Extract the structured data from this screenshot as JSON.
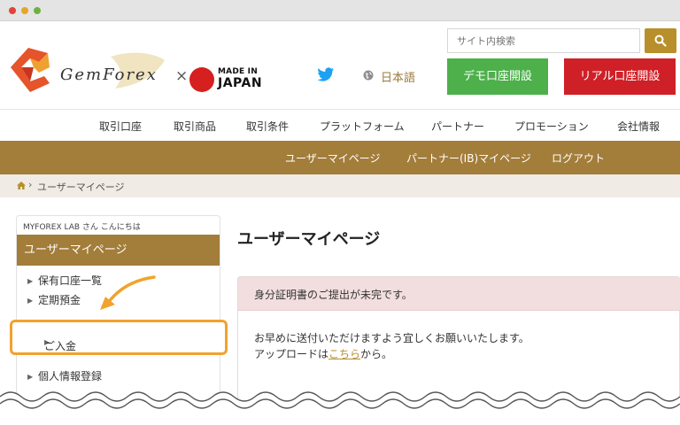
{
  "brand": {
    "logo_text": "GemForex",
    "cross": "×",
    "made_in_line1": "MADE IN",
    "made_in_line2": "JAPAN"
  },
  "header": {
    "search_placeholder": "サイト内検索",
    "language": "日本語",
    "demo_button": "デモ口座開設",
    "real_button": "リアル口座開設"
  },
  "main_nav": [
    "取引口座",
    "取引商品",
    "取引条件",
    "プラットフォーム",
    "パートナー",
    "プロモーション",
    "会社情報"
  ],
  "user_nav": [
    "ユーザーマイページ",
    "パートナー(IB)マイページ",
    "ログアウト"
  ],
  "breadcrumb": {
    "separator": "›",
    "current": "ユーザーマイページ"
  },
  "sidebar": {
    "greeting": "MYFOREX LAB さん こんにちは",
    "heading": "ユーザーマイページ",
    "items": [
      "保有口座一覧",
      "定期預金",
      "ご入金",
      "個人情報登録"
    ]
  },
  "main": {
    "title": "ユーザーマイページ",
    "alert_title": "身分証明書のご提出が未完です。",
    "alert_line1": "お早めに送付いただけますよう宜しくお願いいたします。",
    "alert_line2_before": "アップロードは",
    "alert_link": "こちら",
    "alert_line2_after": "から。"
  },
  "colors": {
    "brand_brown": "#a37d3a",
    "demo_green": "#4db04b",
    "real_red": "#cf2027",
    "highlight_orange": "#f2a22d",
    "alert_bg": "#f2dede"
  },
  "icons": [
    "twitter-icon",
    "globe-icon",
    "search-icon",
    "home-icon",
    "pointer-arrow-icon"
  ]
}
